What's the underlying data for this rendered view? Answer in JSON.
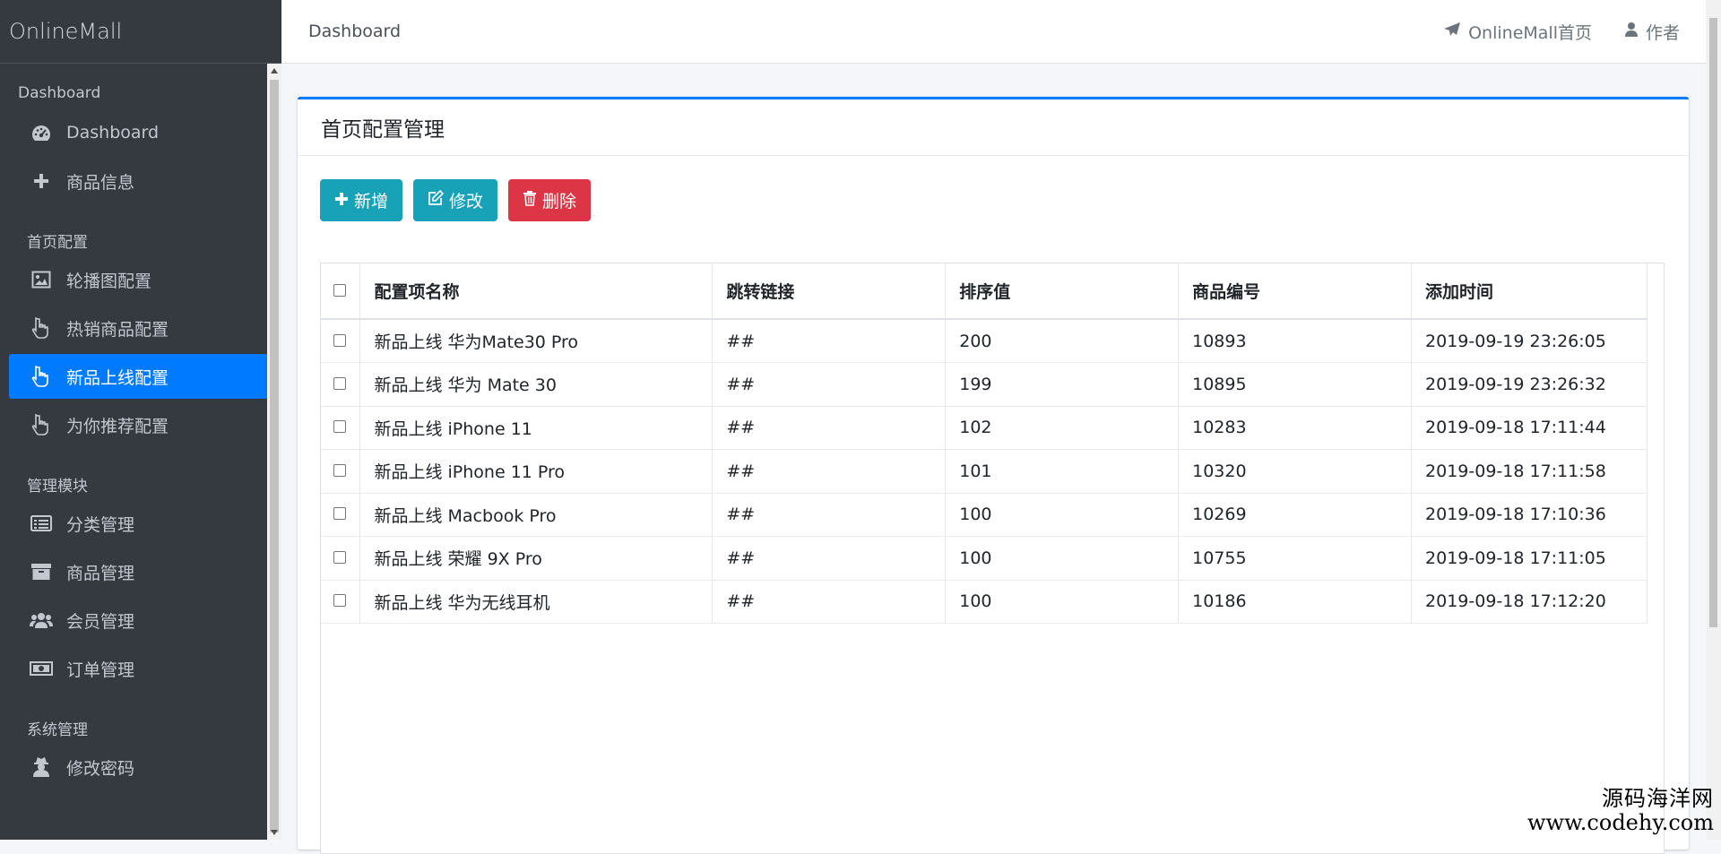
{
  "app": {
    "brand": "OnlineMall"
  },
  "sidebar": {
    "sections": [
      {
        "header": "Dashboard",
        "items": [
          {
            "label": "Dashboard",
            "icon": "tachometer-icon"
          },
          {
            "label": "商品信息",
            "icon": "plus-icon"
          }
        ]
      },
      {
        "header": "首页配置",
        "items": [
          {
            "label": "轮播图配置",
            "icon": "image-icon"
          },
          {
            "label": "热销商品配置",
            "icon": "hand-pointer-icon"
          },
          {
            "label": "新品上线配置",
            "icon": "hand-pointer-icon",
            "active": true
          },
          {
            "label": "为你推荐配置",
            "icon": "hand-pointer-icon"
          }
        ]
      },
      {
        "header": "管理模块",
        "items": [
          {
            "label": "分类管理",
            "icon": "list-alt-icon"
          },
          {
            "label": "商品管理",
            "icon": "archive-icon"
          },
          {
            "label": "会员管理",
            "icon": "users-icon"
          },
          {
            "label": "订单管理",
            "icon": "money-icon"
          }
        ]
      },
      {
        "header": "系统管理",
        "items": [
          {
            "label": "修改密码",
            "icon": "user-secret-icon"
          }
        ]
      }
    ]
  },
  "topbar": {
    "breadcrumb": "Dashboard",
    "home_link": "OnlineMall首页",
    "author_link": "作者"
  },
  "card": {
    "title": "首页配置管理",
    "buttons": {
      "add": "新增",
      "edit": "修改",
      "delete": "删除"
    }
  },
  "table": {
    "columns": [
      "配置项名称",
      "跳转链接",
      "排序值",
      "商品编号",
      "添加时间"
    ],
    "rows": [
      [
        "新品上线 华为Mate30 Pro",
        "##",
        "200",
        "10893",
        "2019-09-19 23:26:05"
      ],
      [
        "新品上线 华为 Mate 30",
        "##",
        "199",
        "10895",
        "2019-09-19 23:26:32"
      ],
      [
        "新品上线 iPhone 11",
        "##",
        "102",
        "10283",
        "2019-09-18 17:11:44"
      ],
      [
        "新品上线 iPhone 11 Pro",
        "##",
        "101",
        "10320",
        "2019-09-18 17:11:58"
      ],
      [
        "新品上线 Macbook Pro",
        "##",
        "100",
        "10269",
        "2019-09-18 17:10:36"
      ],
      [
        "新品上线 荣耀 9X Pro",
        "##",
        "100",
        "10755",
        "2019-09-18 17:11:05"
      ],
      [
        "新品上线 华为无线耳机",
        "##",
        "100",
        "10186",
        "2019-09-18 17:12:20"
      ]
    ]
  },
  "watermark": {
    "line1": "源码海洋网",
    "line2": "www.codehy.com"
  },
  "colors": {
    "sidebar_bg": "#343a40",
    "active": "#007bff",
    "info": "#17a2b8",
    "danger": "#dc3545"
  }
}
